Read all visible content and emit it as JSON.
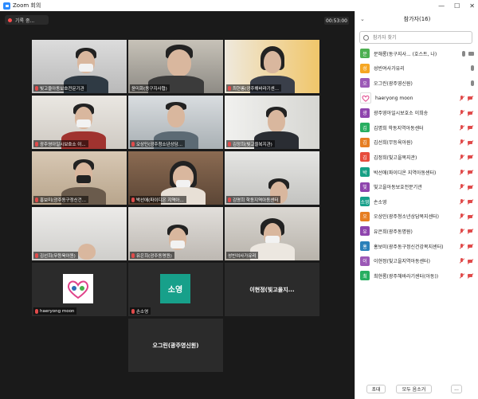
{
  "window": {
    "title": "Zoom 회의",
    "controls": [
      "—",
      "☐",
      "✕"
    ]
  },
  "toolbar": {
    "recording_label": "기록 중...",
    "timer": "00:53:00"
  },
  "tiles": [
    {
      "name": "빛고을아동보호전문기관"
    },
    {
      "name": "윤미화(동구지사협)"
    },
    {
      "name": "최현롬(광주해바라기센..."
    },
    {
      "name": "광주영아일시보호소 이..."
    },
    {
      "name": "오상민(광주청소년상담..."
    },
    {
      "name": "김정희(빛고을복지관)"
    },
    {
      "name": "홍보미(광주동구정신건..."
    },
    {
      "name": "박선애(파이디온 지역아..."
    },
    {
      "name": "김명희 학동지역아동센터"
    },
    {
      "name": "김선희(무등육아원)"
    },
    {
      "name": "유은희(광주동명원)"
    },
    {
      "name": "성빈여사가유리"
    },
    {
      "name": "haeryong moon",
      "avatar": "avatar-logo"
    },
    {
      "name": "손소영",
      "avatar_text": "소영"
    },
    {
      "name": "",
      "center_text": "이현정(빛고을지..."
    },
    {
      "name": "",
      "center_text": "오그린(광주영신원)"
    }
  ],
  "participants_panel": {
    "title": "참가자(16)",
    "search_placeholder": "참가자 찾기",
    "participants": [
      {
        "initial": "문",
        "color": "#4caf50",
        "name": "문해롱(동구지사... (호스트, 나)",
        "mic": "on",
        "cam": "on"
      },
      {
        "initial": "성",
        "color": "#f5a623",
        "name": "성빈여사가유리",
        "mic": "on",
        "cam": "none"
      },
      {
        "initial": "오",
        "color": "#9b59b6",
        "name": "오그린(광주영신원)",
        "mic": "on",
        "cam": "none"
      },
      {
        "initial": "",
        "color": "#ffffff",
        "name": "haeryong moon",
        "mic": "off",
        "cam": "off",
        "logo": true
      },
      {
        "initial": "광",
        "color": "#8e44ad",
        "name": "광주영아일시보호소 이희송",
        "mic": "off",
        "cam": "off"
      },
      {
        "initial": "김",
        "color": "#27ae60",
        "name": "김명희 학동지역아동센터",
        "mic": "off",
        "cam": "off"
      },
      {
        "initial": "김",
        "color": "#e67e22",
        "name": "김선희(무등육아원)",
        "mic": "off",
        "cam": "off"
      },
      {
        "initial": "김",
        "color": "#e74c3c",
        "name": "김정희(빛고을복지관)",
        "mic": "off",
        "cam": "off"
      },
      {
        "initial": "박",
        "color": "#16a085",
        "name": "박선애(파이디온 지역아동센터)",
        "mic": "off",
        "cam": "off"
      },
      {
        "initial": "빛",
        "color": "#8e44ad",
        "name": "빛고을아동보호전문기관",
        "mic": "off",
        "cam": "off"
      },
      {
        "initial": "소영",
        "color": "#17a08a",
        "name": "손소영",
        "mic": "off",
        "cam": "off"
      },
      {
        "initial": "오",
        "color": "#e67e22",
        "name": "오상민(광주청소년상담복지센터)",
        "mic": "off",
        "cam": "off"
      },
      {
        "initial": "유",
        "color": "#8e44ad",
        "name": "유은희(광주동명원)",
        "mic": "off",
        "cam": "off"
      },
      {
        "initial": "홍",
        "color": "#2980b9",
        "name": "홍보미(광주동구정신건강복지센터)",
        "mic": "off",
        "cam": "off"
      },
      {
        "initial": "이",
        "color": "#9b59b6",
        "name": "이현정(빛고을지역아동센터)",
        "mic": "off",
        "cam": "off"
      },
      {
        "initial": "최",
        "color": "#27ae60",
        "name": "최현롬(광주해바라기센터(아동))",
        "mic": "off",
        "cam": "off"
      }
    ],
    "footer": {
      "invite_label": "초대",
      "mute_all_label": "모두 음소거",
      "more_label": "..."
    }
  },
  "colors": {
    "meeting_bg": "#1a1a1a",
    "tile_bg": "#2b2b2b",
    "active_speaker": "#d7e34a",
    "muted": "#e04b4b",
    "accent": "#2d8cff"
  }
}
